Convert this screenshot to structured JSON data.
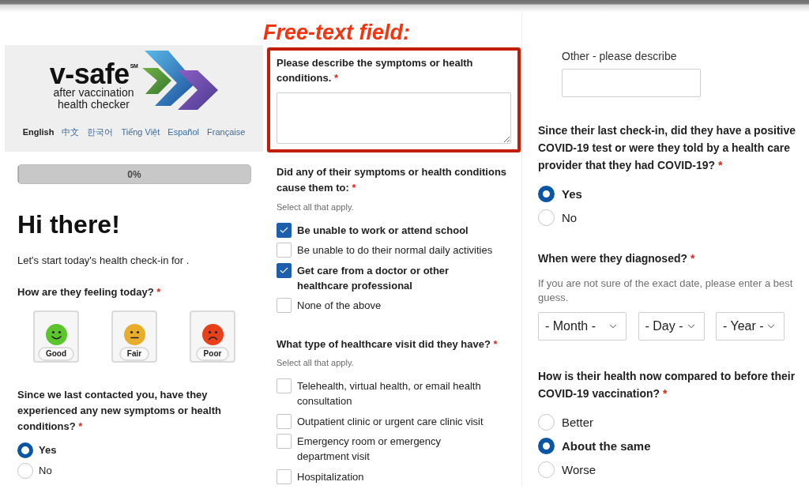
{
  "left_column": {
    "logo": {
      "wordmark": "v-safe$^{SM}$",
      "tagline": [
        "after vaccination",
        "health checker"
      ]
    },
    "languages": [
      {
        "label": "English",
        "selected": true
      },
      {
        "label": "中文",
        "selected": false
      },
      {
        "label": "한국어",
        "selected": false
      },
      {
        "label": "Tiếng Việt",
        "selected": false
      },
      {
        "label": "Español",
        "selected": false
      },
      {
        "label": "Française",
        "selected": false
      }
    ],
    "progress": {
      "level": 0,
      "reading": "0%"
    },
    "heading": "Hi there!",
    "intro": "Let's start today's health check-in for .",
    "questions": [
      {
        "kind": "mood",
        "label": "How are they feeling today?",
        "required_mark": "*",
        "options": [
          {
            "label": "Good",
            "kind": "good",
            "color": "#5cc52e",
            "selected": false
          },
          {
            "label": "Fair",
            "kind": "fair",
            "color": "#e9ad2c",
            "selected": false
          },
          {
            "label": "Poor",
            "kind": "poor",
            "color": "#e8401d",
            "selected": false
          }
        ]
      },
      {
        "kind": "radio",
        "label": "Since we last contacted you, have they experienced any new symptoms or health conditions?",
        "required_mark": "*",
        "options": [
          {
            "label": "Yes",
            "selected": true
          },
          {
            "label": "No",
            "selected": false
          }
        ]
      }
    ]
  },
  "middle_column": {
    "annotation": "Free-text field:",
    "questions": [
      {
        "kind": "textarea",
        "highlighted": true,
        "label": "Please describe the symptoms or health conditions.",
        "required_mark": "*"
      },
      {
        "kind": "checkbox",
        "label": "Did any of their symptoms or health conditions cause them to:",
        "required_mark": "*",
        "hint": "Select all that apply.",
        "options": [
          {
            "label": "Be unable to work or attend school",
            "checked": true
          },
          {
            "label": "Be unable to do their normal daily activities",
            "checked": false
          },
          {
            "label": "Get care from a doctor or other healthcare professional",
            "checked": true
          },
          {
            "label": "None of the above",
            "checked": false
          }
        ]
      },
      {
        "kind": "checkbox",
        "label": "What type of healthcare visit did they have?",
        "required_mark": "*",
        "hint": "Select all that apply.",
        "options": [
          {
            "label": "Telehealth, virtual health, or email health consultation",
            "checked": false
          },
          {
            "label": "Outpatient clinic or urgent care clinic visit",
            "checked": false
          },
          {
            "label": "Emergency room or emergency department visit",
            "checked": false
          },
          {
            "label": "Hospitalization",
            "checked": false
          }
        ]
      }
    ]
  },
  "right_column": {
    "questions": [
      {
        "kind": "text_input",
        "label": "Other - please describe"
      },
      {
        "kind": "radio",
        "label": "Since their last check-in, did they have a positive COVID-19 test or were they told by a health care provider that they had COVID-19?",
        "required_mark": "*",
        "options": [
          {
            "label": "Yes",
            "selected": true
          },
          {
            "label": "No",
            "selected": false
          }
        ]
      },
      {
        "kind": "date",
        "label": "When were they diagnosed?",
        "required_mark": "*",
        "hint": "If you are not sure of the exact date, please enter a best guess.",
        "selects": [
          {
            "value": "- Month -"
          },
          {
            "value": "- Day -"
          },
          {
            "value": "- Year -"
          }
        ]
      },
      {
        "kind": "radio",
        "label": "How is their health now compared to before their COVID-19 vaccination?",
        "required_mark": "*",
        "options": [
          {
            "label": "Better",
            "selected": false
          },
          {
            "label": "About the same",
            "selected": true
          },
          {
            "label": "Worse",
            "selected": false
          }
        ]
      }
    ]
  }
}
